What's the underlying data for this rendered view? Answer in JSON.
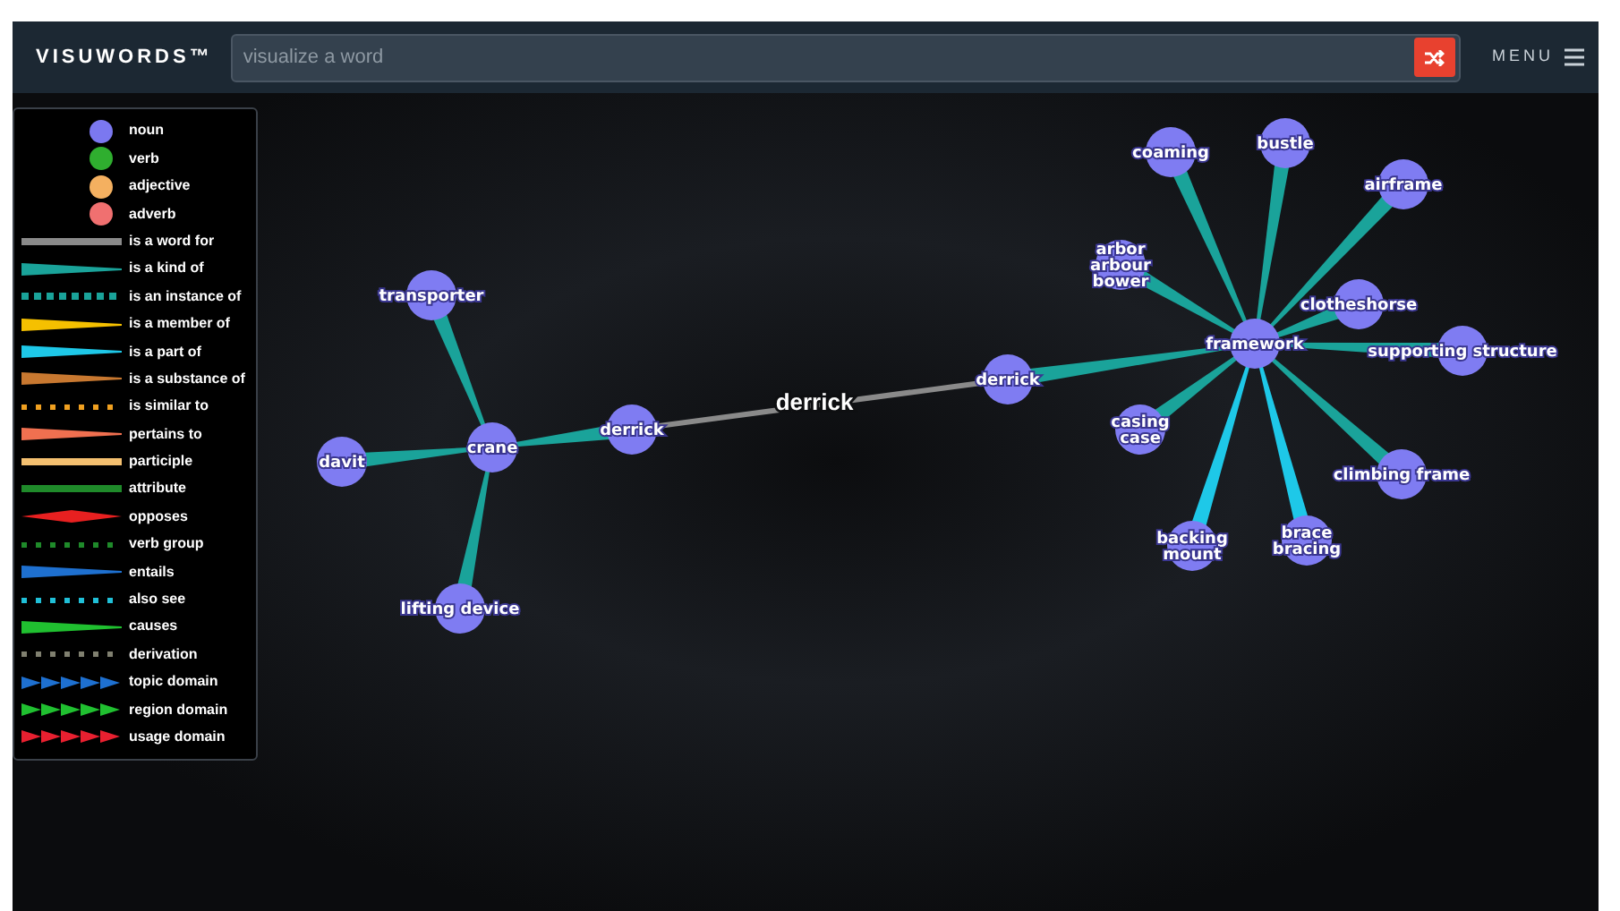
{
  "header": {
    "logo": "VISUWORDS™",
    "search": {
      "placeholder": "visualize a word"
    },
    "menu_label": "MENU"
  },
  "legend": [
    {
      "label": "noun",
      "kind": "node",
      "color": "#7b78f0"
    },
    {
      "label": "verb",
      "kind": "node",
      "color": "#2fae2f"
    },
    {
      "label": "adjective",
      "kind": "node",
      "color": "#f4b060"
    },
    {
      "label": "adverb",
      "kind": "node",
      "color": "#f07070"
    },
    {
      "label": "is a word for",
      "kind": "solid",
      "color": "#8a8a8a"
    },
    {
      "label": "is a kind of",
      "kind": "taper",
      "color": "#1aa39a"
    },
    {
      "label": "is an instance of",
      "kind": "dashed",
      "color": "#1aa39a"
    },
    {
      "label": "is a member of",
      "kind": "taper",
      "color": "#f5c000"
    },
    {
      "label": "is a part of",
      "kind": "taper",
      "color": "#1ec8e8"
    },
    {
      "label": "is a substance of",
      "kind": "taper",
      "color": "#c87830"
    },
    {
      "label": "is similar to",
      "kind": "dotted",
      "color": "#f0a020"
    },
    {
      "label": "pertains to",
      "kind": "taper",
      "color": "#f07050"
    },
    {
      "label": "participle",
      "kind": "solid",
      "color": "#f4c070"
    },
    {
      "label": "attribute",
      "kind": "solid",
      "color": "#1f8a2a"
    },
    {
      "label": "opposes",
      "kind": "diamond",
      "color": "#e82020"
    },
    {
      "label": "verb group",
      "kind": "dotted",
      "color": "#1f8a2a"
    },
    {
      "label": "entails",
      "kind": "taper",
      "color": "#1e70d0"
    },
    {
      "label": "also see",
      "kind": "dotted",
      "color": "#20c0d8"
    },
    {
      "label": "causes",
      "kind": "taper",
      "color": "#20c030"
    },
    {
      "label": "derivation",
      "kind": "dotted",
      "color": "#808070"
    },
    {
      "label": "topic domain",
      "kind": "arrows",
      "color": "#1e70d0"
    },
    {
      "label": "region domain",
      "kind": "arrows",
      "color": "#20c030"
    },
    {
      "label": "usage domain",
      "kind": "arrows",
      "color": "#e82030"
    }
  ],
  "graph": {
    "nodes": [
      {
        "lines": [
          "transporter"
        ]
      },
      {
        "lines": [
          "davit"
        ]
      },
      {
        "lines": [
          "crane"
        ]
      },
      {
        "lines": [
          "lifting device"
        ]
      },
      {
        "lines": [
          "derrick"
        ]
      },
      {
        "lines": [
          "derrick"
        ]
      },
      {
        "lines": [
          "framework"
        ]
      },
      {
        "lines": [
          "coaming"
        ]
      },
      {
        "lines": [
          "bustle"
        ]
      },
      {
        "lines": [
          "airframe"
        ]
      },
      {
        "lines": [
          "arbor",
          "arbour",
          "bower"
        ]
      },
      {
        "lines": [
          "clotheshorse"
        ]
      },
      {
        "lines": [
          "supporting structure"
        ]
      },
      {
        "lines": [
          "casing",
          "case"
        ]
      },
      {
        "lines": [
          "climbing frame"
        ]
      },
      {
        "lines": [
          "backing",
          "mount"
        ]
      },
      {
        "lines": [
          "brace",
          "bracing"
        ]
      }
    ],
    "edges": [
      {
        "kind": "kind_of"
      },
      {
        "kind": "kind_of"
      },
      {
        "kind": "kind_of"
      },
      {
        "kind": "kind_of"
      },
      {
        "kind": "word_for",
        "label": "derrick"
      },
      {
        "kind": "kind_of"
      },
      {
        "kind": "kind_of"
      },
      {
        "kind": "kind_of"
      },
      {
        "kind": "kind_of"
      },
      {
        "kind": "kind_of"
      },
      {
        "kind": "kind_of"
      },
      {
        "kind": "kind_of"
      },
      {
        "kind": "kind_of"
      },
      {
        "kind": "kind_of"
      },
      {
        "kind": "part_of"
      },
      {
        "kind": "part_of"
      }
    ]
  }
}
